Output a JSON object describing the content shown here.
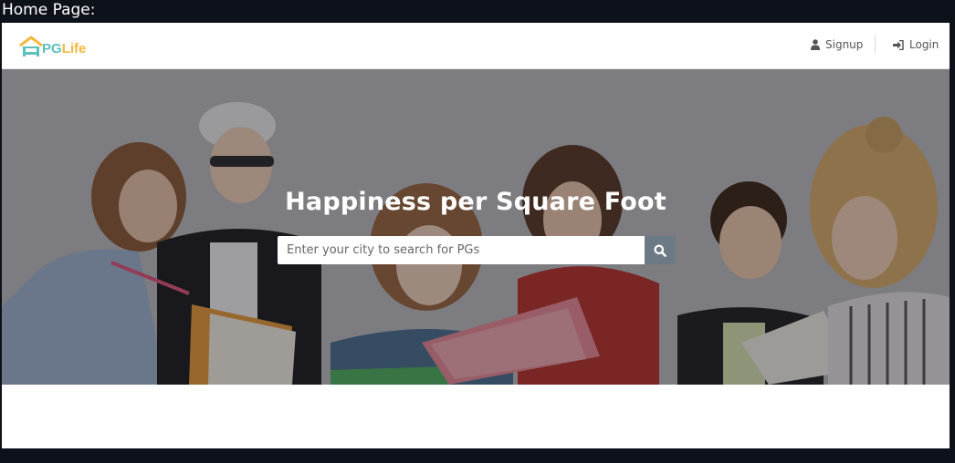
{
  "caption": "Home Page:",
  "brand": {
    "part1": "PG",
    "part2": "Life"
  },
  "nav": {
    "signup": {
      "label": "Signup",
      "icon": "user-icon"
    },
    "login": {
      "label": "Login",
      "icon": "sign-in-icon"
    }
  },
  "hero": {
    "title": "Happiness per Square Foot",
    "search": {
      "placeholder": "Enter your city to search for PGs",
      "value": "",
      "icon": "search-icon"
    }
  },
  "colors": {
    "logo_teal": "#5bc0be",
    "logo_yellow": "#f5b83d",
    "search_button": "#6c7a86"
  }
}
